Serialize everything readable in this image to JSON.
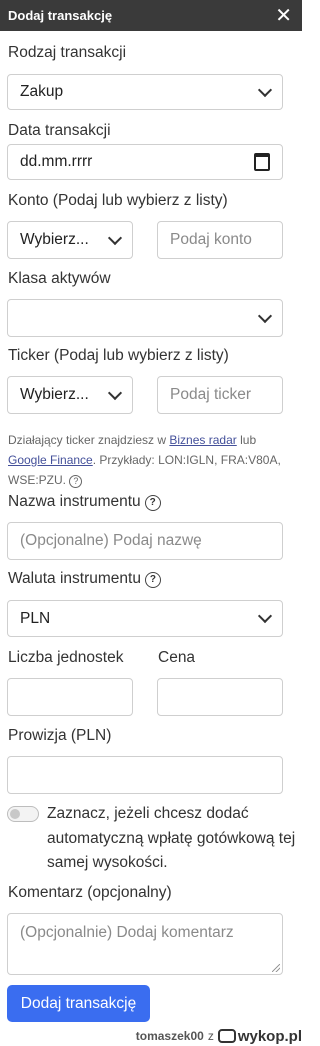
{
  "header": {
    "title": "Dodaj transakcję",
    "close_icon": "close-icon"
  },
  "form": {
    "transaction_type": {
      "label": "Rodzaj transakcji",
      "value": "Zakup"
    },
    "transaction_date": {
      "label": "Data transakcji",
      "value": "dd.mm.rrrr"
    },
    "account": {
      "label": "Konto (Podaj lub wybierz z listy)",
      "select_value": "Wybierz...",
      "input_placeholder": "Podaj konto"
    },
    "asset_class": {
      "label": "Klasa aktywów",
      "value": ""
    },
    "ticker": {
      "label": "Ticker (Podaj lub wybierz z listy)",
      "select_value": "Wybierz...",
      "input_placeholder": "Podaj ticker"
    },
    "hint": {
      "prefix": "Działający ticker znajdziesz w ",
      "link1": "Biznes radar",
      "middle": " lub ",
      "link2": "Google Finance",
      "suffix": ". Przykłady: LON:IGLN, FRA:V80A, WSE:PZU."
    },
    "instrument_name": {
      "label": "Nazwa instrumentu",
      "placeholder": "(Opcjonalne) Podaj nazwę"
    },
    "instrument_currency": {
      "label": "Waluta instrumentu",
      "value": "PLN"
    },
    "units": {
      "label": "Liczba jednostek"
    },
    "price": {
      "label": "Cena"
    },
    "commission": {
      "label": "Prowizja (PLN)"
    },
    "auto_deposit": {
      "text": "Zaznacz, jeżeli chcesz dodać automatyczną wpłatę gotówkową tej samej wysokości.",
      "checked": false
    },
    "comment": {
      "label": "Komentarz (opcjonalny)",
      "placeholder": "(Opcjonalnie) Dodaj komentarz"
    },
    "submit_label": "Dodaj transakcję"
  },
  "watermark": {
    "user": "tomaszek00",
    "separator": "z",
    "site": "wykop.pl"
  }
}
